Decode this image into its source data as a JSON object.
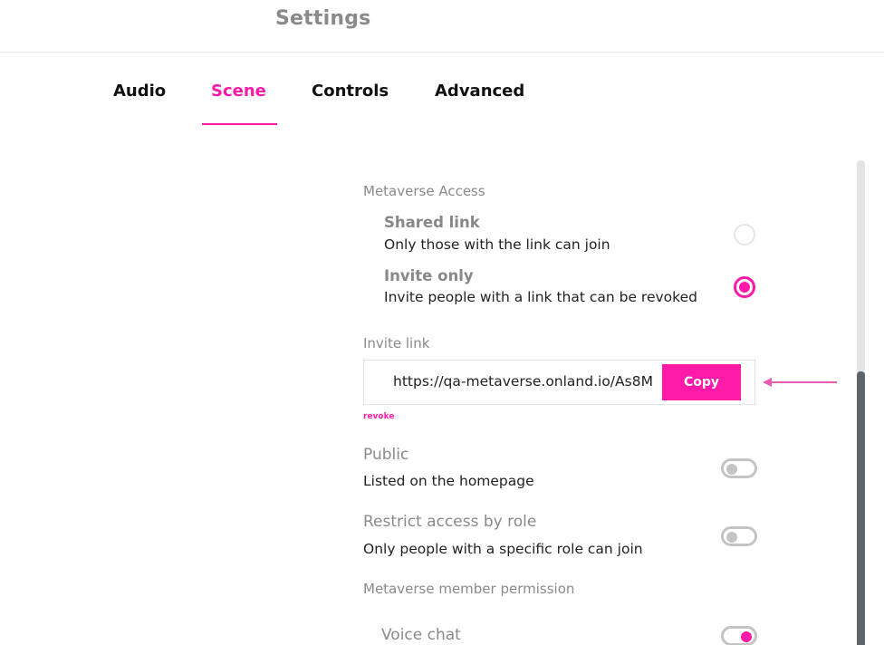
{
  "header": {
    "title": "Settings"
  },
  "tabs": [
    {
      "label": "Audio",
      "active": false
    },
    {
      "label": "Scene",
      "active": true
    },
    {
      "label": "Controls",
      "active": false
    },
    {
      "label": "Advanced",
      "active": false
    }
  ],
  "access": {
    "section_label": "Metaverse Access",
    "options": [
      {
        "title": "Shared link",
        "description": "Only those with the link can join",
        "selected": false
      },
      {
        "title": "Invite only",
        "description": "Invite people with a link that can be revoked",
        "selected": true
      }
    ]
  },
  "invite_link": {
    "label": "Invite link",
    "value": "https://qa-metaverse.onland.io/As8M",
    "copy_label": "Copy",
    "revoke_label": "revoke"
  },
  "toggles": [
    {
      "title": "Public",
      "description": "Listed on the homepage",
      "on": false
    },
    {
      "title": "Restrict access by role",
      "description": "Only people with a specific role can join",
      "on": false
    }
  ],
  "member_permission": {
    "section_label": "Metaverse member permission",
    "items": [
      {
        "label": "Voice chat",
        "on": true
      }
    ]
  },
  "colors": {
    "accent": "#ff1aa8",
    "muted_text": "#8a8a8a",
    "toggle_off": "#c4c4c4",
    "scroll_thumb": "#5f646b"
  },
  "scroll": {
    "position_fraction": 0.44
  }
}
